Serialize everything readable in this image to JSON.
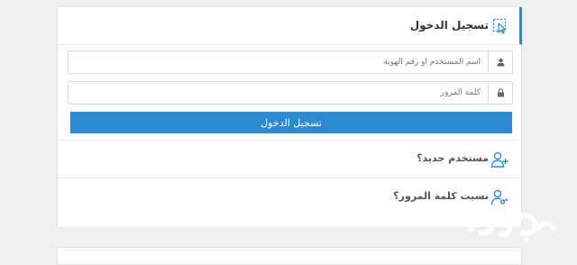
{
  "login_panel": {
    "title": "تسجيل الدخول",
    "title_icon": "cursor-select-icon",
    "username": {
      "icon": "user-icon",
      "placeholder": "اسم المستخدم أو رقم الهوية",
      "value": ""
    },
    "password": {
      "icon": "lock-icon",
      "placeholder": "كلمة المرور",
      "value": ""
    },
    "submit_label": "تسجيل الدخول",
    "links": [
      {
        "label": "مستخدم جديد؟",
        "icon": "add-user-icon"
      },
      {
        "label": "نسيت كلمة المرور؟",
        "icon": "user-key-icon"
      }
    ]
  },
  "colors": {
    "accent": "#2c8ad3",
    "page_background": "#f0f0f0",
    "panel_background": "#ffffff"
  }
}
